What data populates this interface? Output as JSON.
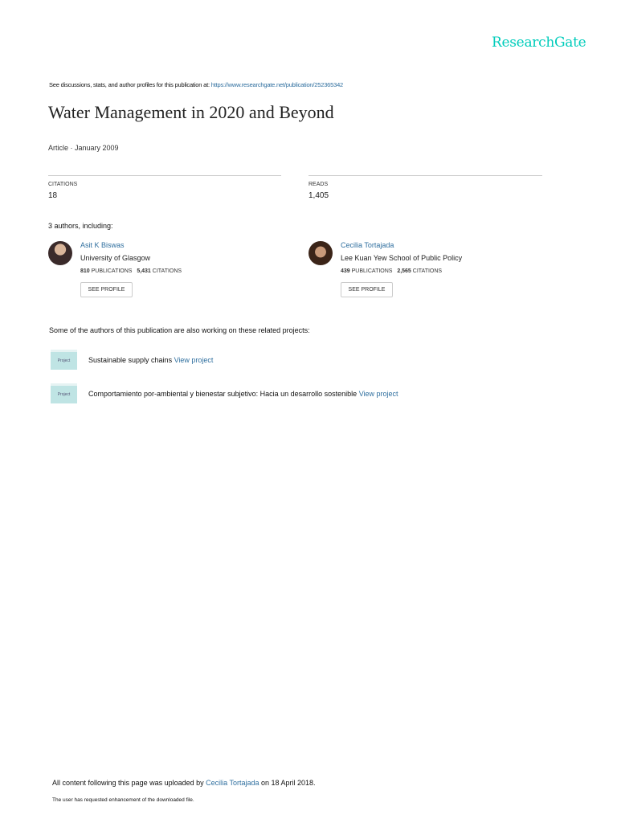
{
  "logo": "ResearchGate",
  "intro": {
    "text": "See discussions, stats, and author profiles for this publication at: ",
    "url": "https://www.researchgate.net/publication/252365342"
  },
  "title": "Water Management in 2020 and Beyond",
  "meta": "Article · January 2009",
  "stats": {
    "citations_label": "CITATIONS",
    "citations": "18",
    "reads_label": "READS",
    "reads": "1,405"
  },
  "authors_heading": "3 authors, including:",
  "authors": [
    {
      "name": "Asit K Biswas",
      "affiliation": "University of Glasgow",
      "publications": "810",
      "pub_label": "PUBLICATIONS",
      "citations": "5,431",
      "cit_label": "CITATIONS",
      "button": "SEE PROFILE"
    },
    {
      "name": "Cecilia Tortajada",
      "affiliation": "Lee Kuan Yew School of Public Policy",
      "publications": "439",
      "pub_label": "PUBLICATIONS",
      "citations": "2,565",
      "cit_label": "CITATIONS",
      "button": "SEE PROFILE"
    }
  ],
  "projects_heading": "Some of the authors of this publication are also working on these related projects:",
  "projects": [
    {
      "icon_label": "Project",
      "name": "Sustainable supply chains ",
      "link": "View project"
    },
    {
      "icon_label": "Project",
      "name": "Comportamiento por-ambiental y bienestar subjetivo: Hacia un desarrollo sostenible ",
      "link": "View project"
    }
  ],
  "footer": {
    "pre": "All content following this page was uploaded by ",
    "user": "Cecilia Tortajada",
    "post": " on 18 April 2018.",
    "note": "The user has requested enhancement of the downloaded file."
  }
}
